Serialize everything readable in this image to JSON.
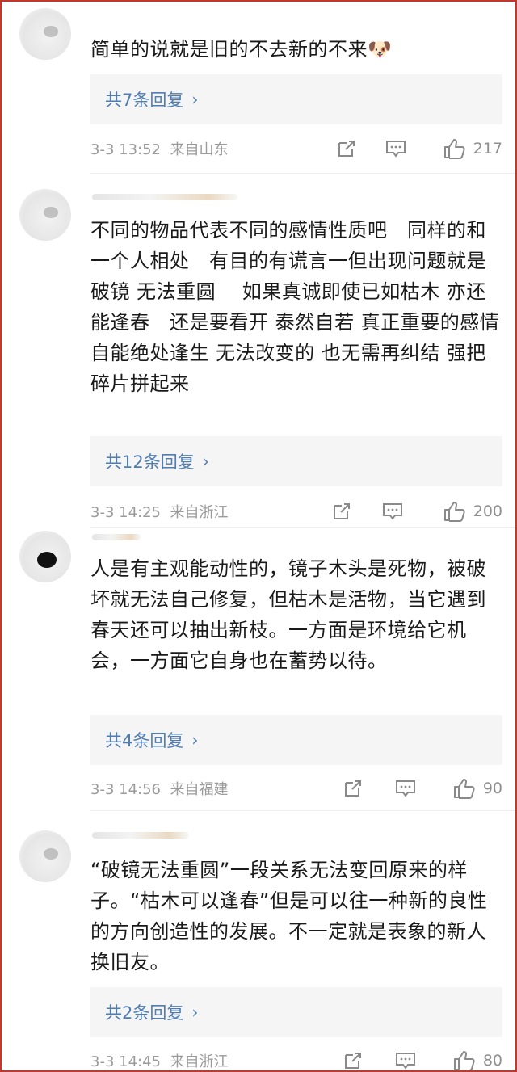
{
  "comments": [
    {
      "text": "简单的说就是旧的不去新的不来🐶",
      "replies_label": "共7条回复",
      "time": "3-3 13:52",
      "location": "来自山东",
      "likes": "217"
    },
    {
      "text": "不同的物品代表不同的感情性质吧　同样的和一个人相处　有目的有谎言一但出现问题就是破镜  无法重圆　 如果真诚即使已如枯木  亦还能逢春　还是要看开 泰然自若  真正重要的感情 自能绝处逢生 无法改变的 也无需再纠结  强把碎片拼起来",
      "replies_label": "共12条回复",
      "time": "3-3 14:25",
      "location": "来自浙江",
      "likes": "200"
    },
    {
      "text": "人是有主观能动性的，镜子木头是死物，被破坏就无法自己修复，但枯木是活物，当它遇到春天还可以抽出新枝。一方面是环境给它机会，一方面它自身也在蓄势以待。",
      "replies_label": "共4条回复",
      "time": "3-3 14:56",
      "location": "来自福建",
      "likes": "90"
    },
    {
      "text": "“破镜无法重圆”一段关系无法变回原来的样子。“枯木可以逢春”但是可以往一种新的良性的方向创造性的发展。不一定就是表象的新人换旧友。",
      "replies_label": "共2条回复",
      "time": "3-3 14:45",
      "location": "来自浙江",
      "likes": "80"
    }
  ],
  "icons": {
    "share": "share-icon",
    "comment": "comment-icon",
    "like": "thumbs-up-icon",
    "chevron": "chevron-right-icon"
  },
  "colors": {
    "frame": "#c0392b",
    "link": "#4f7db4",
    "meta": "#9b9b9b",
    "reply_bg": "#f5f5f5"
  }
}
